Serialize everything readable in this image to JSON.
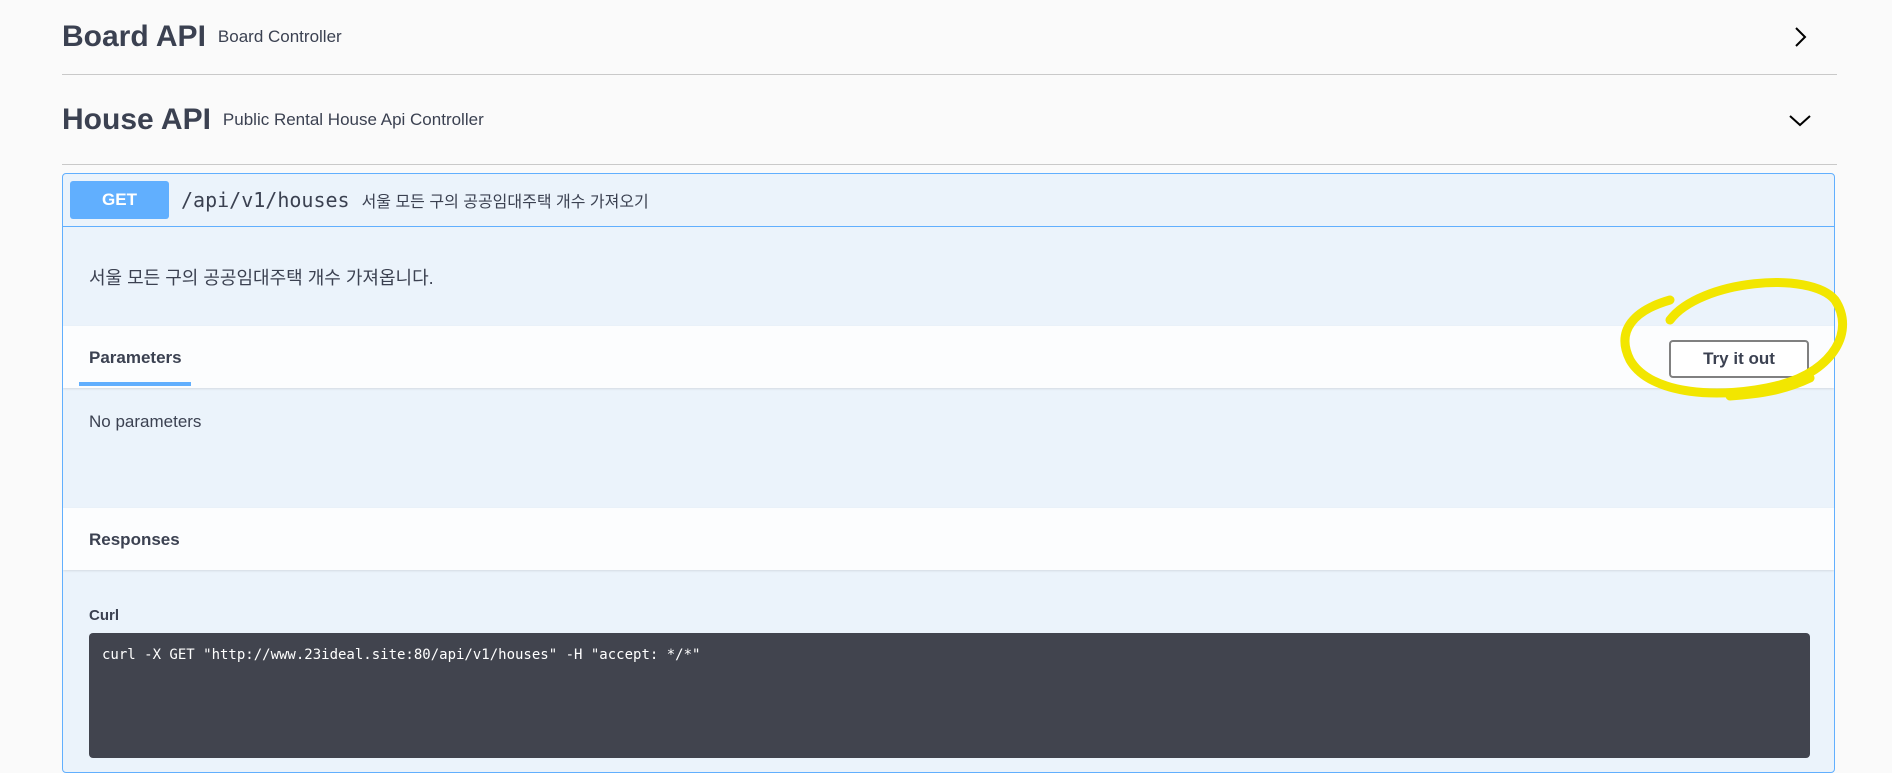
{
  "tags": [
    {
      "title": "Board API",
      "description": "Board Controller",
      "state": "collapsed"
    },
    {
      "title": "House API",
      "description": "Public Rental House Api Controller",
      "state": "expanded"
    }
  ],
  "operation": {
    "method": "GET",
    "path": "/api/v1/houses",
    "summary": "서울 모든 구의 공공임대주택 개수 가져오기",
    "description": "서울 모든 구의 공공임대주택 개수 가져옵니다.",
    "parameters_tab": "Parameters",
    "try_it_out_label": "Try it out",
    "no_parameters_text": "No parameters",
    "responses_label": "Responses",
    "curl_label": "Curl",
    "curl_command": "curl -X GET \"http://www.23ideal.site:80/api/v1/houses\" -H \"accept: */*\""
  },
  "colors": {
    "get_method": "#61affe",
    "curl_background": "#41444e",
    "annotation_highlight": "#f2e600"
  },
  "icons": [
    "chevron-right-icon",
    "chevron-down-icon"
  ]
}
